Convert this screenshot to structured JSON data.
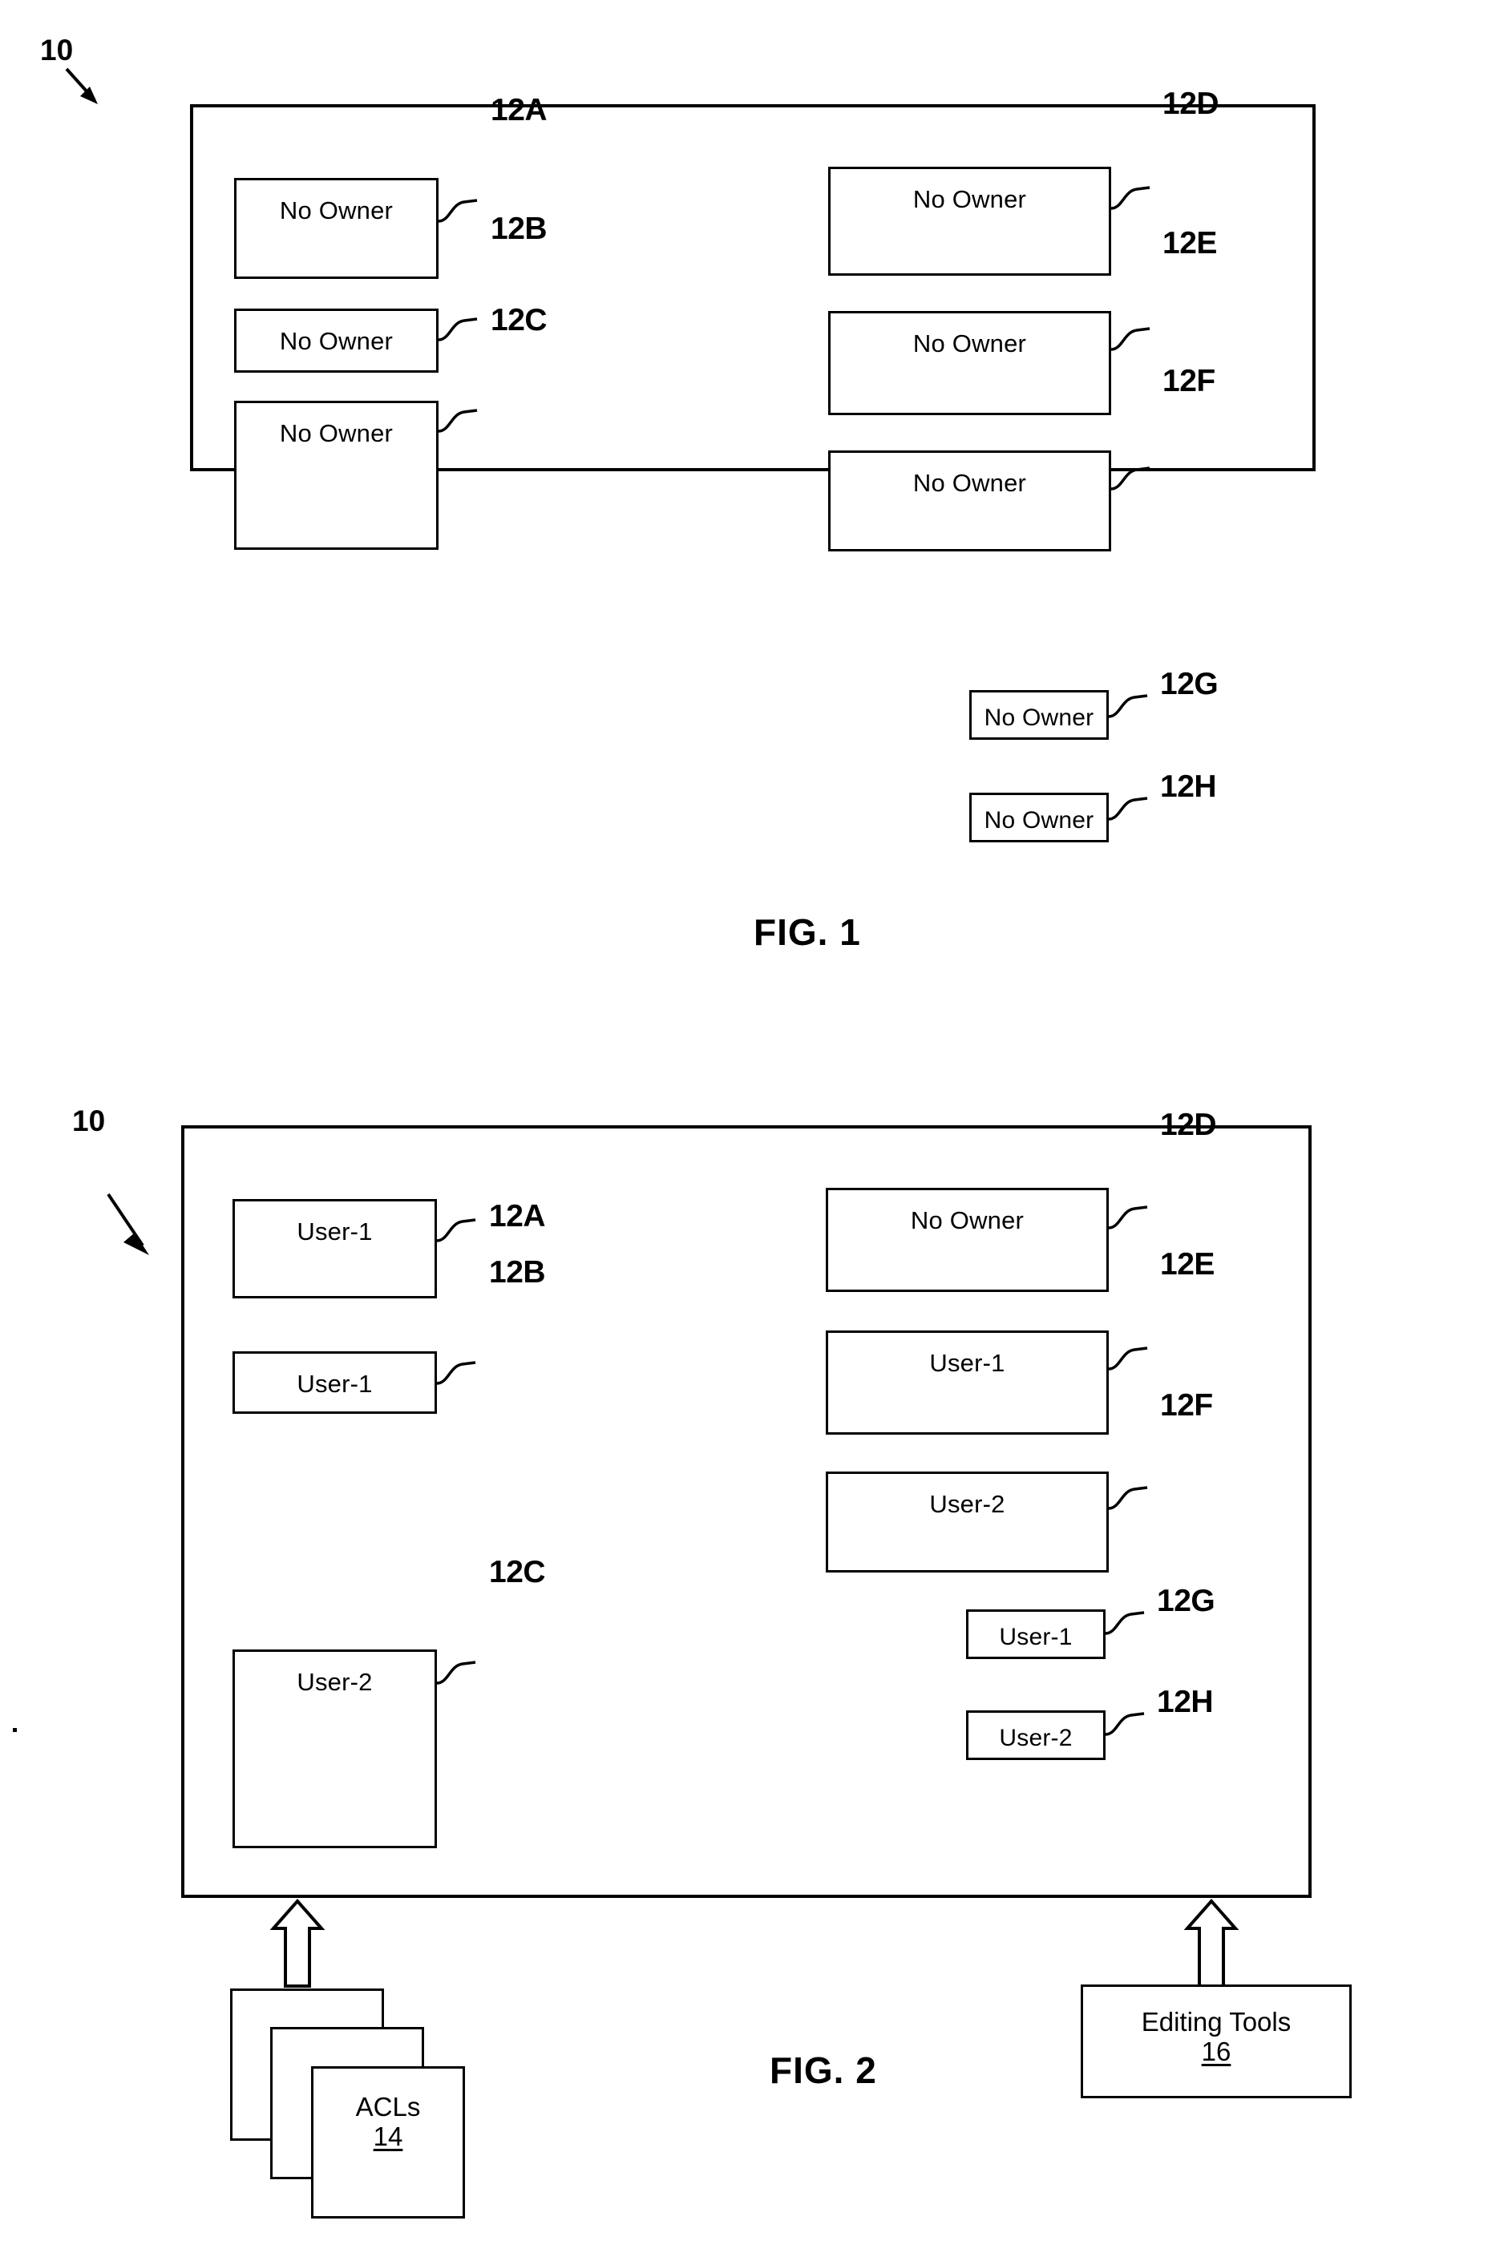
{
  "document": {
    "type": "patent-figure-sheet",
    "figures": [
      "FIG. 1",
      "FIG. 2"
    ]
  },
  "figure1": {
    "caption": "FIG. 1",
    "frame_ref": "10",
    "boxes": [
      {
        "id": "12A",
        "ref": "12A",
        "owner": "No Owner"
      },
      {
        "id": "12B",
        "ref": "12B",
        "owner": "No Owner"
      },
      {
        "id": "12C",
        "ref": "12C",
        "owner": "No Owner"
      },
      {
        "id": "12D",
        "ref": "12D",
        "owner": "No Owner"
      },
      {
        "id": "12E",
        "ref": "12E",
        "owner": "No Owner"
      },
      {
        "id": "12F",
        "ref": "12F",
        "owner": "No Owner"
      },
      {
        "id": "12G",
        "ref": "12G",
        "owner": "No Owner"
      },
      {
        "id": "12H",
        "ref": "12H",
        "owner": "No Owner"
      }
    ]
  },
  "figure2": {
    "caption": "FIG. 2",
    "frame_ref": "10",
    "boxes": [
      {
        "id": "12A",
        "ref": "12A",
        "owner": "User-1"
      },
      {
        "id": "12B",
        "ref": "12B",
        "owner": "User-1"
      },
      {
        "id": "12C",
        "ref": "12C",
        "owner": "User-2"
      },
      {
        "id": "12D",
        "ref": "12D",
        "owner": "No Owner"
      },
      {
        "id": "12E",
        "ref": "12E",
        "owner": "User-1"
      },
      {
        "id": "12F",
        "ref": "12F",
        "owner": "User-2"
      },
      {
        "id": "12G",
        "ref": "12G",
        "owner": "User-1"
      },
      {
        "id": "12H",
        "ref": "12H",
        "owner": "User-2"
      }
    ],
    "sources": [
      {
        "id": "acls",
        "title": "ACLs",
        "ref": "14",
        "stacked": true
      },
      {
        "id": "editing-tools",
        "title": "Editing Tools",
        "ref": "16",
        "stacked": false
      }
    ]
  },
  "colors": {
    "ink": "#000000",
    "paper": "#ffffff"
  }
}
